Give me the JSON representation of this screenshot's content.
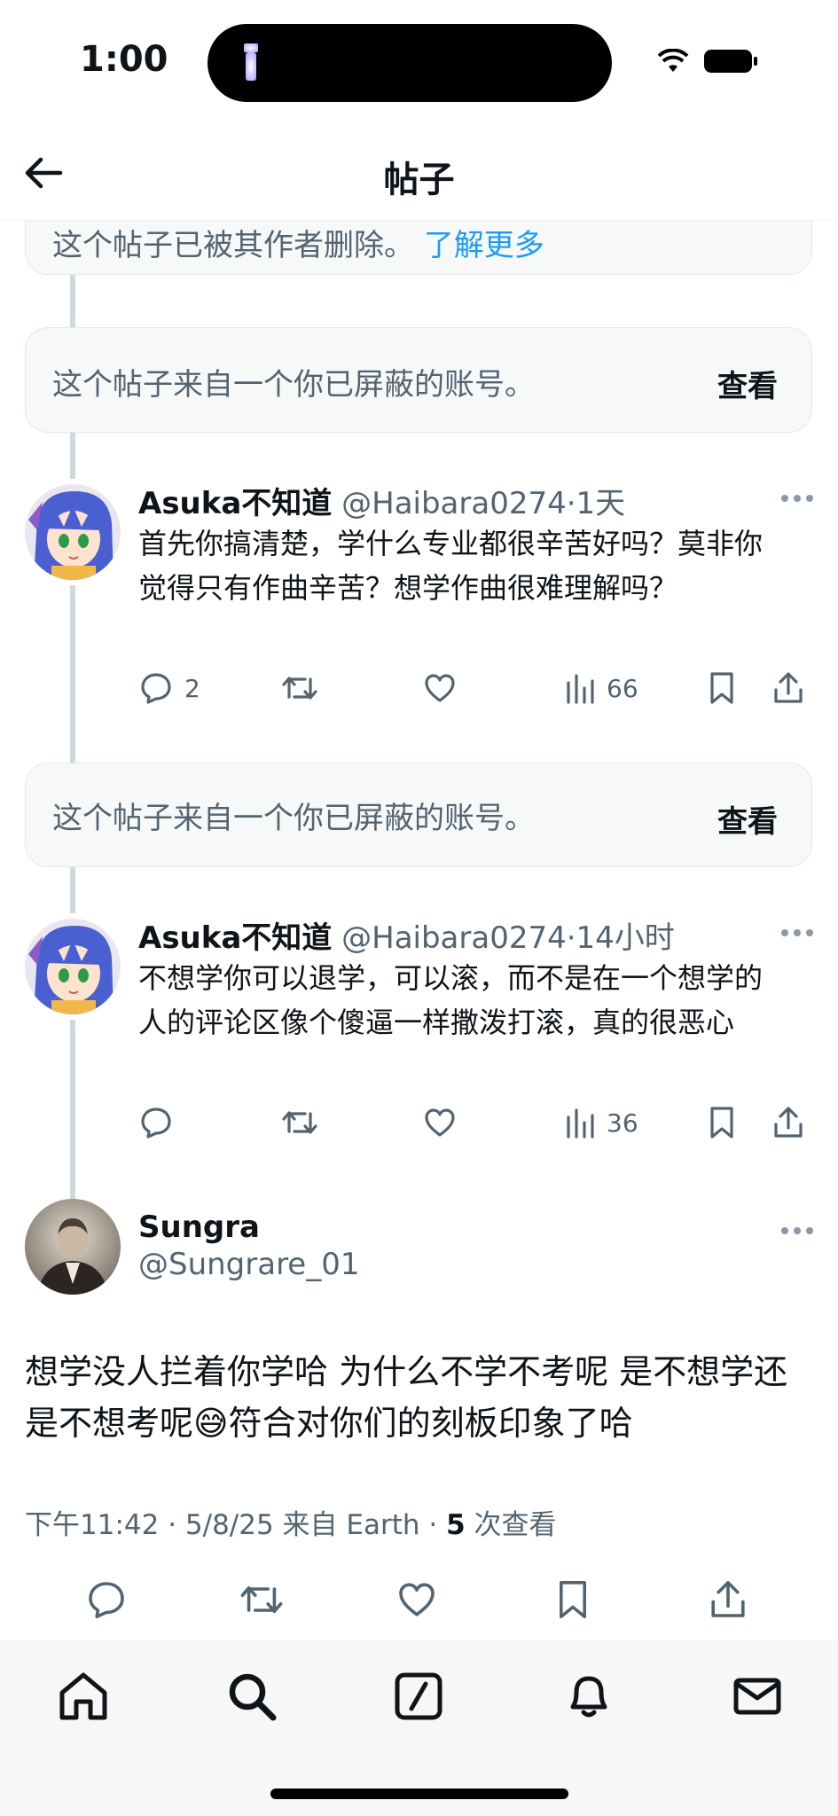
{
  "status": {
    "time": "1:00"
  },
  "header": {
    "title": "帖子"
  },
  "notices": {
    "deleted": {
      "text": "这个帖子已被其作者删除。",
      "link": "了解更多"
    },
    "blocked_1": {
      "text": "这个帖子来自一个你已屏蔽的账号。",
      "action": "查看"
    },
    "blocked_2": {
      "text": "这个帖子来自一个你已屏蔽的账号。",
      "action": "查看"
    }
  },
  "replies": [
    {
      "name": "Asuka不知道",
      "handle": "@Haibara0274",
      "time": "·1天",
      "body": "首先你搞清楚，学什么专业都很辛苦好吗？莫非你觉得只有作曲辛苦？想学作曲很难理解吗？",
      "reply_count": "2",
      "views": "66"
    },
    {
      "name": "Asuka不知道",
      "handle": "@Haibara0274",
      "time": "·14小时",
      "body": "不想学你可以退学，可以滚，而不是在一个想学的人的评论区像个傻逼一样撒泼打滚，真的很恶心",
      "reply_count": "",
      "views": "36"
    }
  ],
  "main_post": {
    "name": "Sungra",
    "handle": "@Sungrare_01",
    "body": "想学没人拦着你学哈 为什么不学不考呢 是不想学还是不想考呢😅符合对你们的刻板印象了哈",
    "meta_time": "下午11:42 · 5/8/25 来自 Earth · ",
    "meta_views": "5",
    "meta_views_label": " 次查看"
  },
  "colors": {
    "accent": "#1d9bf0",
    "secondary_text": "#536471",
    "thread_line": "#cfd9de"
  },
  "icons": {
    "status": [
      "flashlight-icon",
      "wifi-icon",
      "battery-icon"
    ],
    "post_actions": [
      "reply-icon",
      "repost-icon",
      "like-icon",
      "views-icon",
      "bookmark-icon",
      "share-icon"
    ],
    "tabs": [
      "home-icon",
      "search-icon",
      "grok-icon",
      "notifications-icon",
      "messages-icon"
    ]
  }
}
